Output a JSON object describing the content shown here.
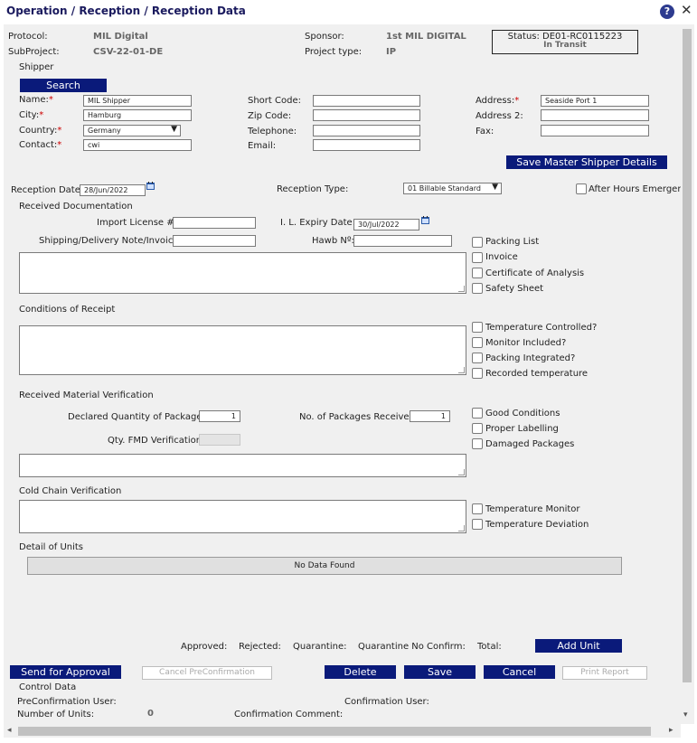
{
  "header": {
    "title": "Operation / Reception / Reception Data",
    "help": "?",
    "close": "✕"
  },
  "info": {
    "protocol_label": "Protocol:",
    "protocol_value": "MIL Digital",
    "subproject_label": "SubProject:",
    "subproject_value": "CSV-22-01-DE",
    "sponsor_label": "Sponsor:",
    "sponsor_value": "1st MIL DIGITAL",
    "projecttype_label": "Project type:",
    "projecttype_value": "IP",
    "status_line": "Status: DE01-RC0115223",
    "status_sub": "In Transit"
  },
  "shipper": {
    "section": "Shipper",
    "search_btn": "Search",
    "name_label": "Name:",
    "name_value": "MIL Shipper",
    "city_label": "City:",
    "city_value": "Hamburg",
    "country_label": "Country:",
    "country_value": "Germany",
    "contact_label": "Contact:",
    "contact_value": "cwi",
    "shortcode_label": "Short Code:",
    "zip_label": "Zip Code:",
    "tel_label": "Telephone:",
    "email_label": "Email:",
    "address_label": "Address:",
    "address_value": "Seaside Port 1",
    "address2_label": "Address 2:",
    "fax_label": "Fax:",
    "save_btn": "Save Master Shipper Details",
    "req": "*"
  },
  "reception": {
    "date_label": "Reception Date:",
    "date_value": "28/Jun/2022",
    "type_label": "Reception Type:",
    "type_value": "01 Billable Standard",
    "after_hours": "After Hours Emerger"
  },
  "docs": {
    "section": "Received Documentation",
    "import_label": "Import License #:",
    "expiry_label": "I. L. Expiry Date:",
    "expiry_value": "30/Jul/2022",
    "note_label": "Shipping/Delivery Note/Invoice:",
    "hawb_label": "Hawb Nº:",
    "checks": [
      "Packing List",
      "Invoice",
      "Certificate of Analysis",
      "Safety Sheet"
    ]
  },
  "conditions": {
    "section": "Conditions of Receipt",
    "checks": [
      "Temperature Controlled?",
      "Monitor Included?",
      "Packing Integrated?",
      "Recorded temperature"
    ]
  },
  "material": {
    "section": "Received Material Verification",
    "declared_label": "Declared Quantity of Packages:",
    "declared_value": "1",
    "received_label": "No. of Packages Received:",
    "received_value": "1",
    "fmd_label": "Qty. FMD Verification:",
    "checks": [
      "Good Conditions",
      "Proper Labelling",
      "Damaged Packages"
    ]
  },
  "cold": {
    "section": "Cold Chain Verification",
    "checks": [
      "Temperature Monitor",
      "Temperature Deviation"
    ]
  },
  "units": {
    "section": "Detail of Units",
    "no_data": "No Data Found"
  },
  "totals": {
    "approved": "Approved:",
    "rejected": "Rejected:",
    "quarantine": "Quarantine:",
    "qnc": "Quarantine No Confirm:",
    "total": "Total:",
    "add_unit": "Add Unit"
  },
  "actions": {
    "send": "Send for Approval",
    "cancel_pre": "Cancel PreConfirmation",
    "delete": "Delete",
    "save": "Save",
    "cancel": "Cancel",
    "print": "Print Report"
  },
  "control": {
    "section": "Control Data",
    "preconf_user": "PreConfirmation User:",
    "conf_user": "Confirmation User:",
    "num_units": "Number of Units:",
    "num_units_value": "0",
    "conf_comment": "Confirmation Comment:"
  },
  "scroll": {
    "left": "◂",
    "right": "▸",
    "down": "▾"
  }
}
